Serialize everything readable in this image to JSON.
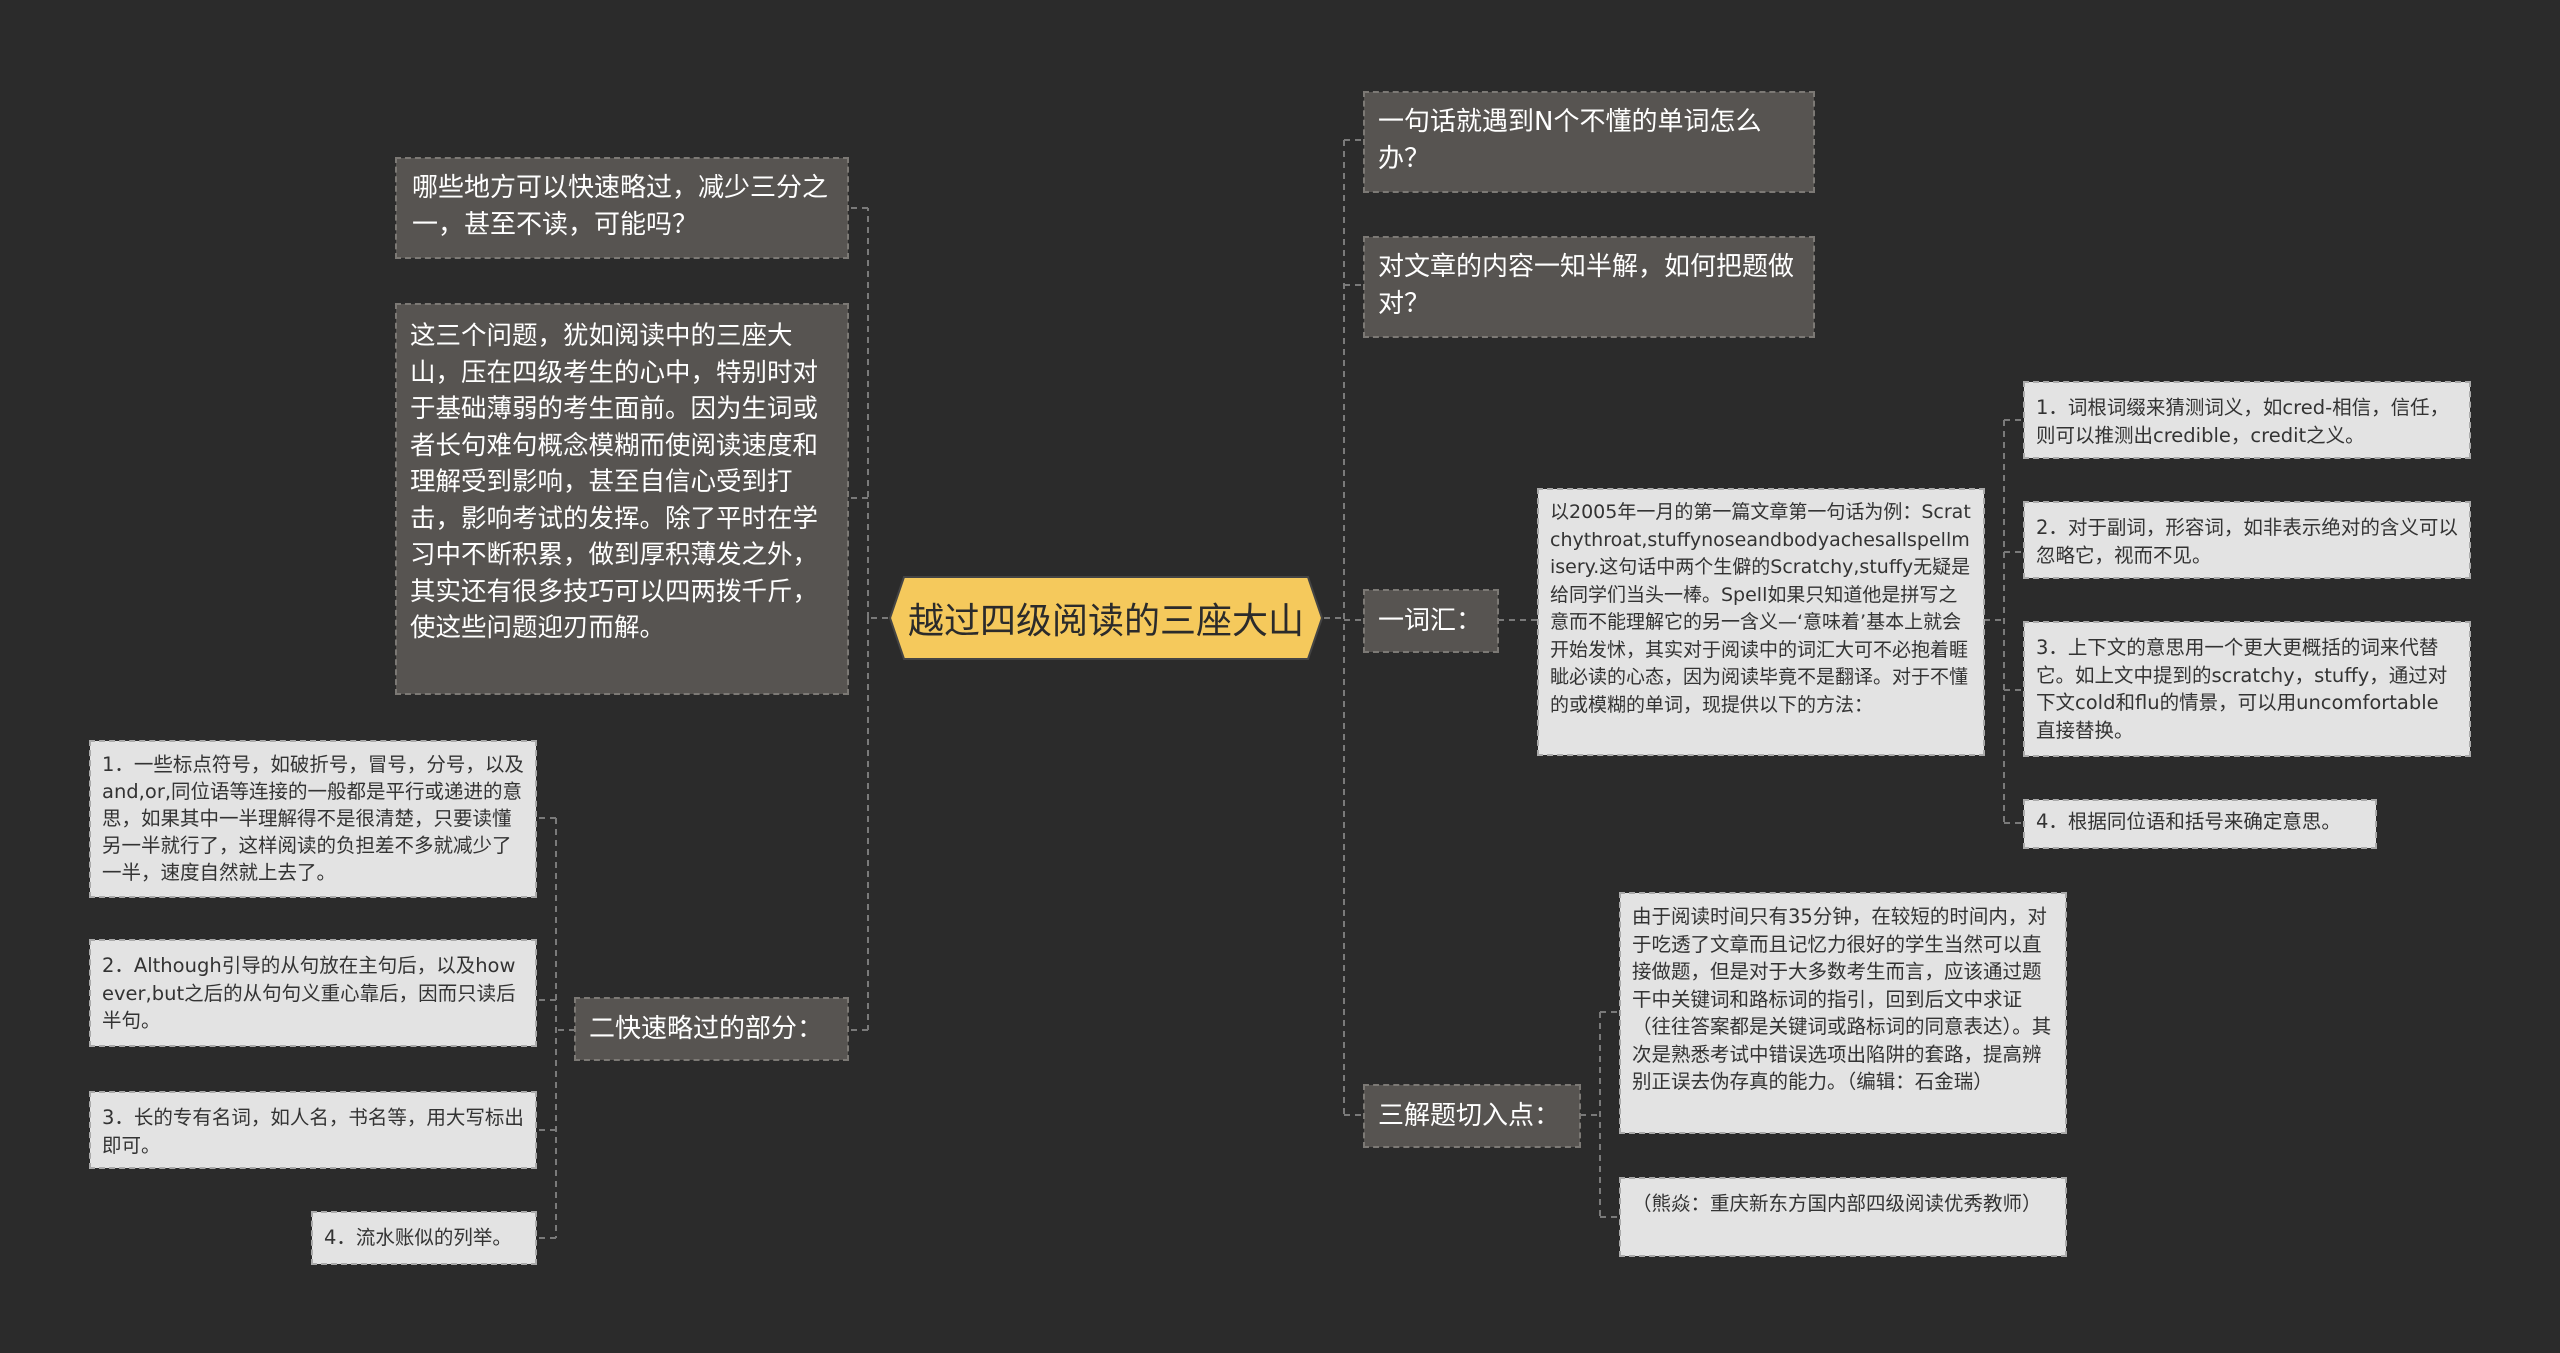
{
  "center": {
    "title": "越过四级阅读的三座大山"
  },
  "left": {
    "question": "哪些地方可以快速略过，减少三分之一，甚至不读，可能吗？",
    "intro": "这三个问题，犹如阅读中的三座大山，压在四级考生的心中，特别时对于基础薄弱的考生面前。因为生词或者长句难句概念模糊而使阅读速度和理解受到影响，甚至自信心受到打击，影响考试的发挥。除了平时在学习中不断积累，做到厚积薄发之外，其实还有很多技巧可以四两拨千斤，使这些问题迎刃而解。",
    "skim": {
      "label": "二快速略过的部分：",
      "items": [
        "1．一些标点符号，如破折号，冒号，分号，以及and,or,同位语等连接的一般都是平行或递进的意思，如果其中一半理解得不是很清楚，只要读懂另一半就行了，这样阅读的负担差不多就减少了一半，速度自然就上去了。",
        "2．Although引导的从句放在主句后，以及however,but之后的从句句义重心靠后，因而只读后半句。",
        "3．长的专有名词，如人名，书名等，用大写标出即可。",
        "4．流水账似的列举。"
      ]
    }
  },
  "right": {
    "q1": "一句话就遇到N个不懂的单词怎么办？",
    "q2": "对文章的内容一知半解，如何把题做对？",
    "vocab": {
      "label": "一词汇：",
      "detail": "以2005年一月的第一篇文章第一句话为例：Scratchythroat,stuffynoseandbodyachesallspellmisery.这句话中两个生僻的Scratchy,stuffy无疑是给同学们当头一棒。Spell如果只知道他是拼写之意而不能理解它的另一含义—‘意味着’基本上就会开始发怵，其实对于阅读中的词汇大可不必抱着睚眦必读的心态，因为阅读毕竟不是翻译。对于不懂的或模糊的单词，现提供以下的方法：",
      "methods": [
        "1．词根词缀来猜测词义，如cred-相信，信任，则可以推测出credible，credit之义。",
        "2．对于副词，形容词，如非表示绝对的含义可以忽略它，视而不见。",
        "3．上下文的意思用一个更大更概括的词来代替它。如上文中提到的scratchy，stuffy，通过对下文cold和flu的情景，可以用uncomfortable直接替换。",
        "4．根据同位语和括号来确定意思。"
      ]
    },
    "solve": {
      "label": "三解题切入点：",
      "detail": "由于阅读时间只有35分钟，在较短的时间内，对于吃透了文章而且记忆力很好的学生当然可以直接做题，但是对于大多数考生而言，应该通过题干中关键词和路标词的指引，回到后文中求证（往往答案都是关键词或路标词的同意表达）。其次是熟悉考试中错误选项出陷阱的套路，提高辨别正误去伪存真的能力。（编辑：石金瑞）",
      "author": "（熊焱：重庆新东方国内部四级阅读优秀教师）"
    }
  },
  "colors": {
    "background": "#2b2b2b",
    "center_fill": "#f5c95c",
    "dark_node": "#575451",
    "light_node": "#e3e3e3",
    "connector": "#7a7a7a"
  }
}
